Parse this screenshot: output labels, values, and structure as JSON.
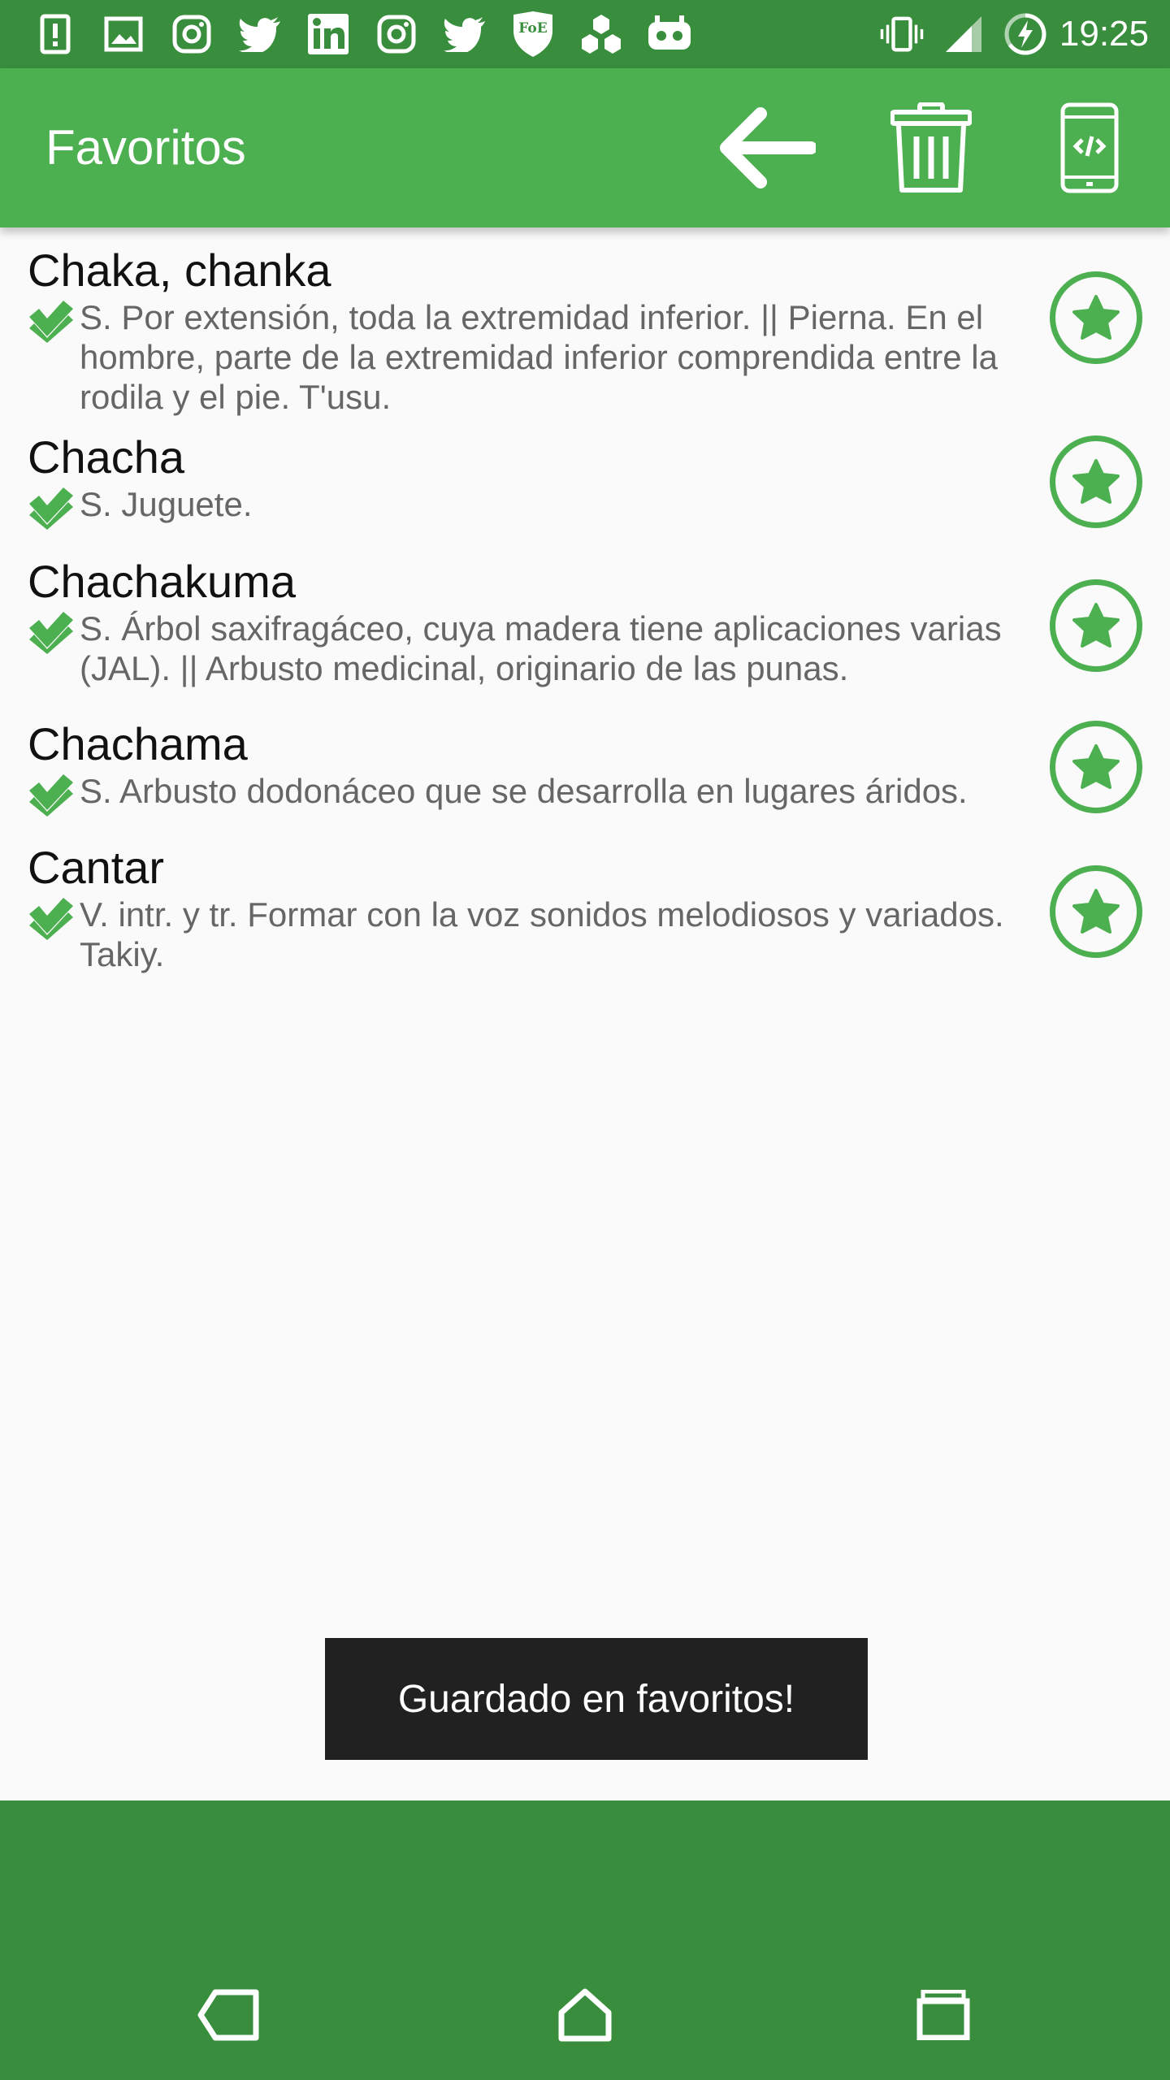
{
  "status_bar": {
    "time": "19:25",
    "left_icons": [
      "alert-icon",
      "image-icon",
      "instagram-icon",
      "twitter-icon",
      "linkedin-icon",
      "instagram-icon",
      "twitter-icon",
      "foe-icon",
      "hexagons-icon",
      "game-icon"
    ],
    "foe_label": "FoE",
    "right_icons": [
      "vibrate-icon",
      "signal-icon",
      "battery-charging-icon"
    ]
  },
  "app_bar": {
    "title": "Favoritos",
    "icons": [
      "back-arrow-icon",
      "trash-icon",
      "phone-code-icon"
    ]
  },
  "favorites": [
    {
      "word": "Chaka, chanka",
      "definition": "S. Por extensión, toda la extremidad inferior. || Pierna. En el hombre, parte de la extremidad inferior comprendida entre la rodila y el pie. T'usu."
    },
    {
      "word": "Chacha",
      "definition": "S. Juguete."
    },
    {
      "word": "Chachakuma",
      "definition": "S. Árbol saxifragáceo, cuya madera tiene aplicaciones varias (JAL). || Arbusto medicinal, originario de las punas."
    },
    {
      "word": "Chachama",
      "definition": "S. Arbusto dodonáceo que se desarrolla en lugares áridos."
    },
    {
      "word": "Cantar",
      "definition": "V. intr. y tr. Formar con la voz sonidos melodiosos y variados. Takiy."
    }
  ],
  "toast": {
    "message": "Guardado en favoritos!"
  },
  "nav_bar": {
    "icons": [
      "nav-back-icon",
      "nav-home-icon",
      "nav-recents-icon"
    ]
  },
  "colors": {
    "primary": "#4caf50",
    "primary_dark": "#388e3c",
    "toast_bg": "#212121"
  }
}
